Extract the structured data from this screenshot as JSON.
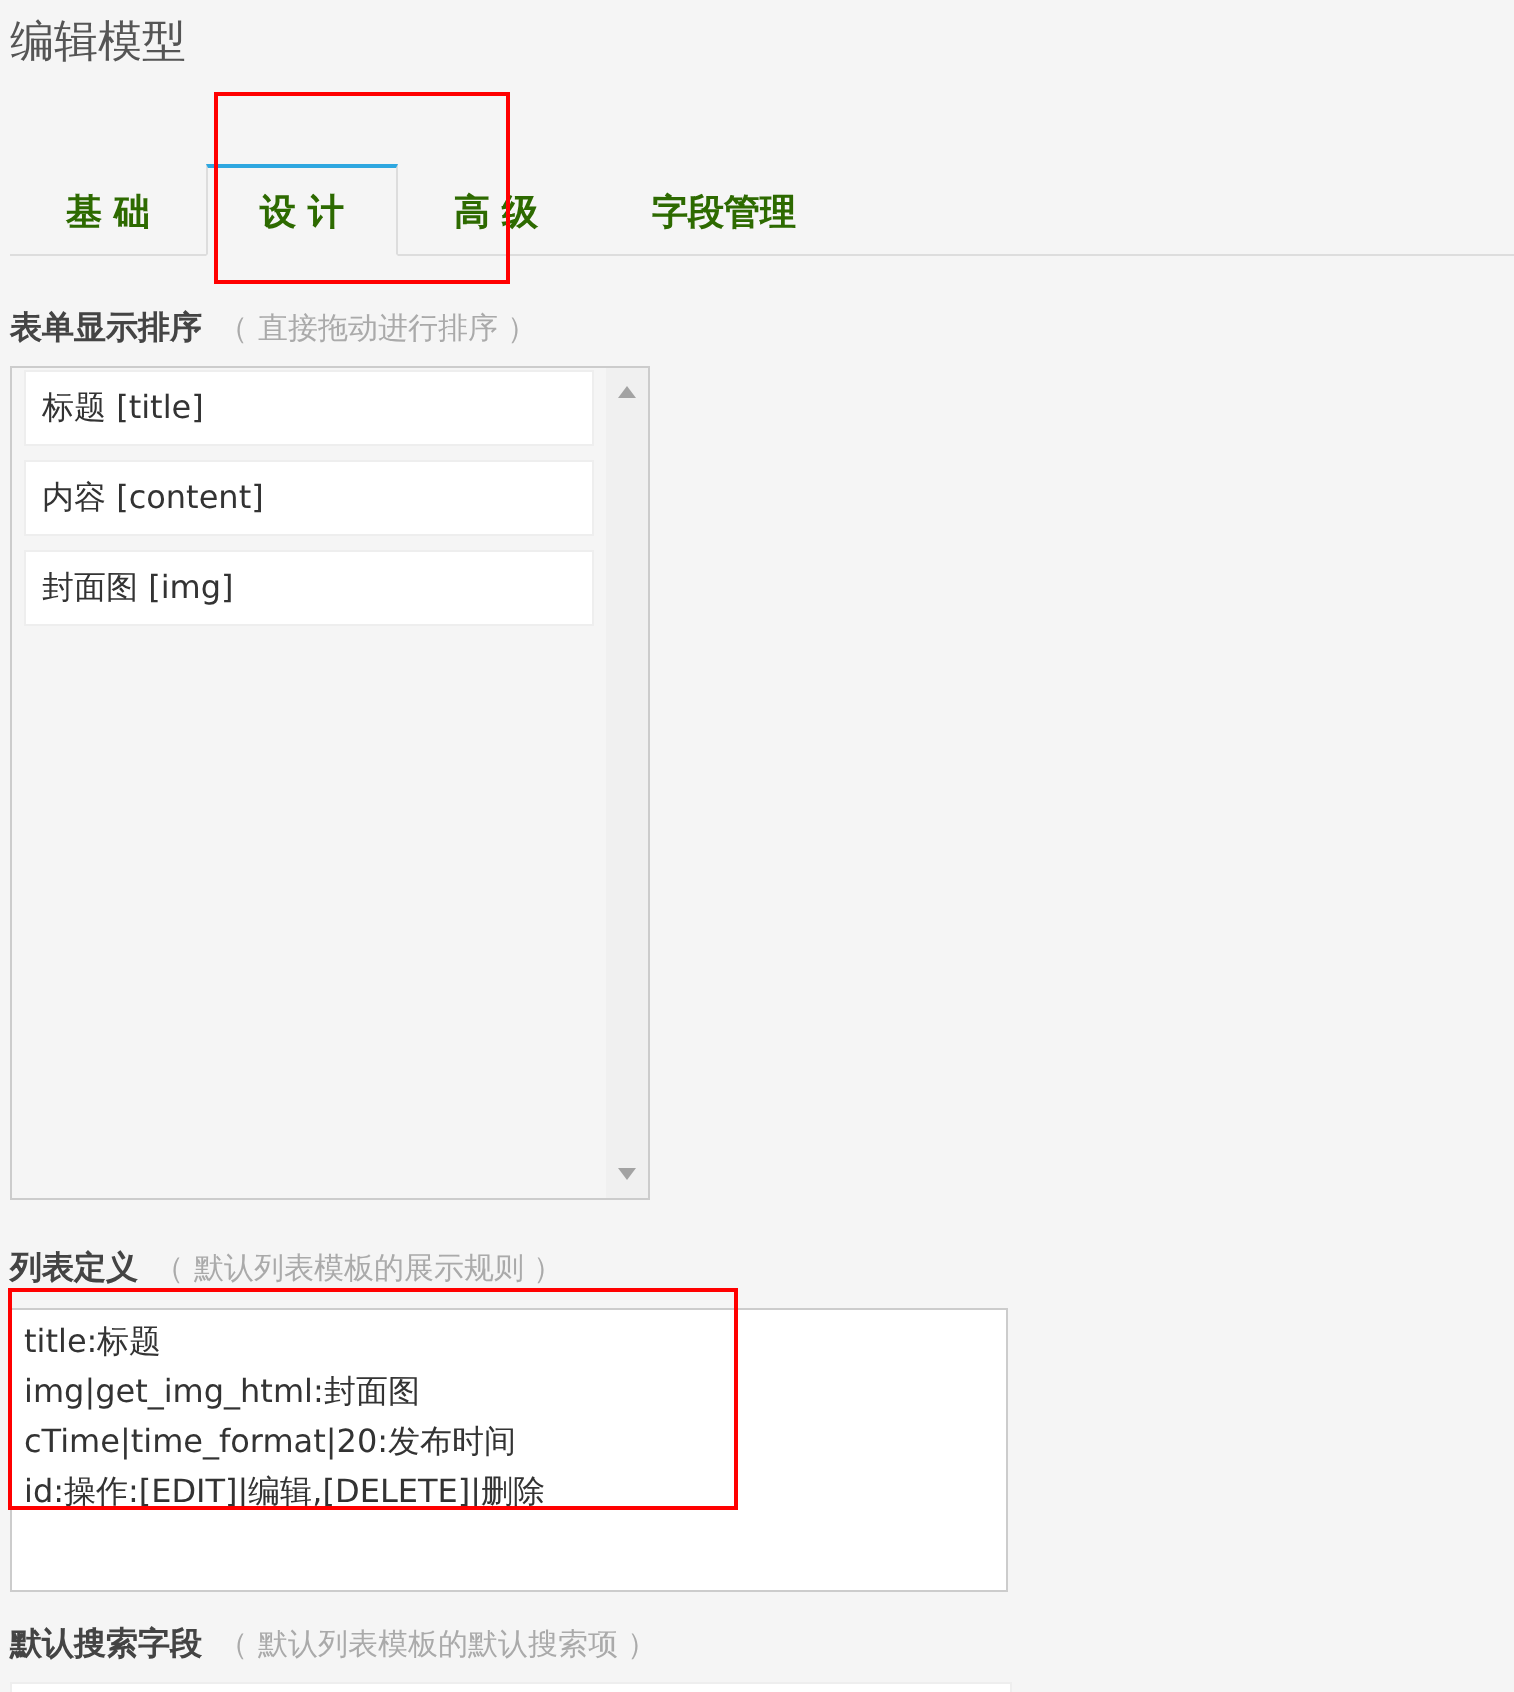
{
  "page_title": "编辑模型",
  "tabs": [
    {
      "label": "基 础",
      "selected": false
    },
    {
      "label": "设 计",
      "selected": true
    },
    {
      "label": "高 级",
      "selected": false
    },
    {
      "label": "字段管理",
      "selected": false
    }
  ],
  "form_order": {
    "label": "表单显示排序",
    "hint": "（ 直接拖动进行排序 ）",
    "items": [
      "标题 [title]",
      "内容 [content]",
      "封面图 [img]"
    ]
  },
  "list_definition": {
    "label": "列表定义",
    "hint": "（ 默认列表模板的展示规则 ）",
    "value": "title:标题\nimg|get_img_html:封面图\ncTime|time_format|20:发布时间\nid:操作:[EDIT]|编辑,[DELETE]|删除"
  },
  "search_fields": {
    "label": "默认搜索字段",
    "hint": "（ 默认列表模板的默认搜索项 ）"
  }
}
